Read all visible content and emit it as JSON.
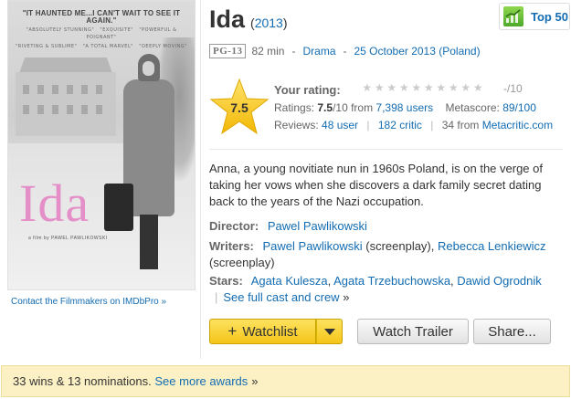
{
  "poster": {
    "headline": "\"IT HAUNTED ME...I CAN'T WAIT TO SEE IT AGAIN.\"",
    "quotes": [
      "\"ABSOLUTELY STUNNING\"",
      "\"EXQUISITE\"",
      "\"POWERFUL & POIGNANT\"",
      "\"RIVETING & SUBLIME\"",
      "\"A TOTAL MARVEL\"",
      "\"DEEPLY MOVING\""
    ],
    "title": "Ida",
    "credit": "a film by PAWEL PAWLIKOWSKI",
    "contact_link": "Contact the Filmmakers on IMDbPro »"
  },
  "header": {
    "title": "Ida",
    "year": "2013",
    "top50_label": "Top 50"
  },
  "infobar": {
    "certificate": "PG-13",
    "runtime": "82 min",
    "genre": "Drama",
    "release": "25 October 2013 (Poland)",
    "separator": "-"
  },
  "rating": {
    "star_value": "7.5",
    "your_rating_label": "Your rating:",
    "your_rating_value": "-/10",
    "star_count": 10,
    "ratings_prefix": "Ratings:",
    "score": "7.5",
    "score_suffix": "/10 from",
    "users_link": "7,398 users",
    "metascore_label": "Metascore:",
    "metascore_link": "89/100",
    "reviews_label": "Reviews:",
    "user_reviews": "48 user",
    "critic_reviews": "182 critic",
    "from_prefix": "34 from",
    "metacritic_link": "Metacritic.com"
  },
  "description": "Anna, a young novitiate nun in 1960s Poland, is on the verge of taking her vows when she discovers a dark family secret dating back to the years of the Nazi occupation.",
  "credits": {
    "director_label": "Director:",
    "director": "Pawel Pawlikowski",
    "writers_label": "Writers:",
    "writer1": "Pawel Pawlikowski",
    "writer1_role": "(screenplay),",
    "writer2": "Rebecca Lenkiewicz",
    "writer2_role": "(screenplay)",
    "stars_label": "Stars:",
    "star1": "Agata Kulesza",
    "star2": "Agata Trzebuchowska",
    "star3": "Dawid Ogrodnik",
    "full_cast": "See full cast and crew",
    "raquo": "»",
    "comma": ","
  },
  "buttons": {
    "watchlist_plus": "+",
    "watchlist": "Watchlist",
    "trailer": "Watch Trailer",
    "share": "Share..."
  },
  "awards": {
    "text": "33 wins & 13 nominations.",
    "link": "See more awards",
    "raquo": "»"
  },
  "colors": {
    "link": "#136cb2",
    "watchlist_yellow": "#f5c518",
    "awards_bg": "#fcf1c5",
    "poster_title_pink": "#e48fc8"
  }
}
